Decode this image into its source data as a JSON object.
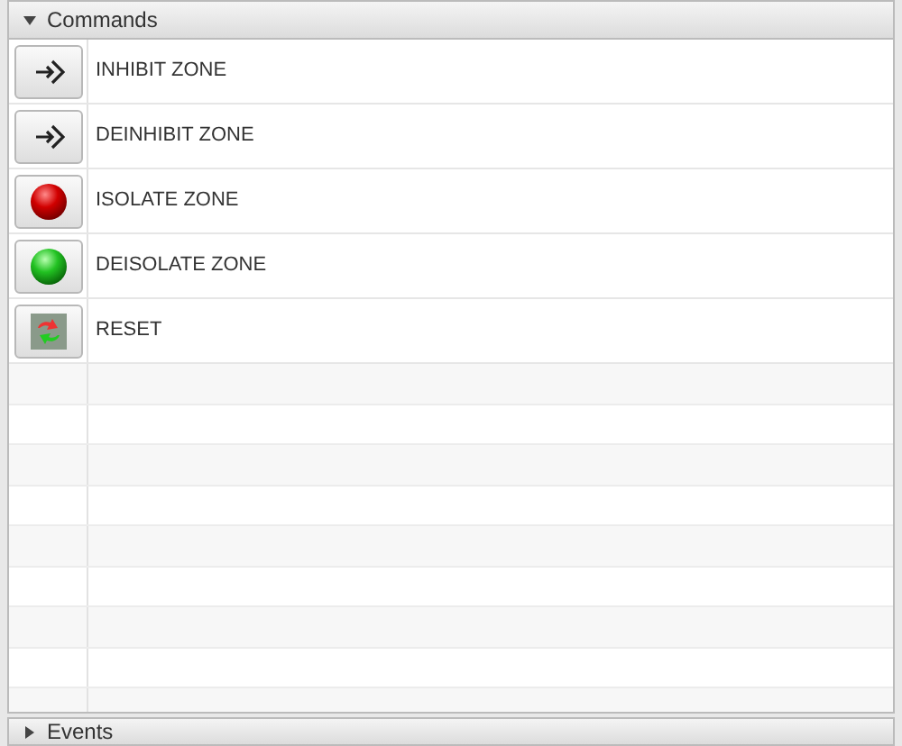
{
  "panels": [
    {
      "title": "Commands",
      "expanded": true,
      "commands": [
        {
          "kind": "enter",
          "label": "INHIBIT ZONE"
        },
        {
          "kind": "enter",
          "label": "DEINHIBIT ZONE"
        },
        {
          "kind": "red",
          "label": "ISOLATE ZONE"
        },
        {
          "kind": "green",
          "label": "DEISOLATE ZONE"
        },
        {
          "kind": "reset",
          "label": "RESET"
        }
      ]
    },
    {
      "title": "Events",
      "expanded": false
    }
  ]
}
